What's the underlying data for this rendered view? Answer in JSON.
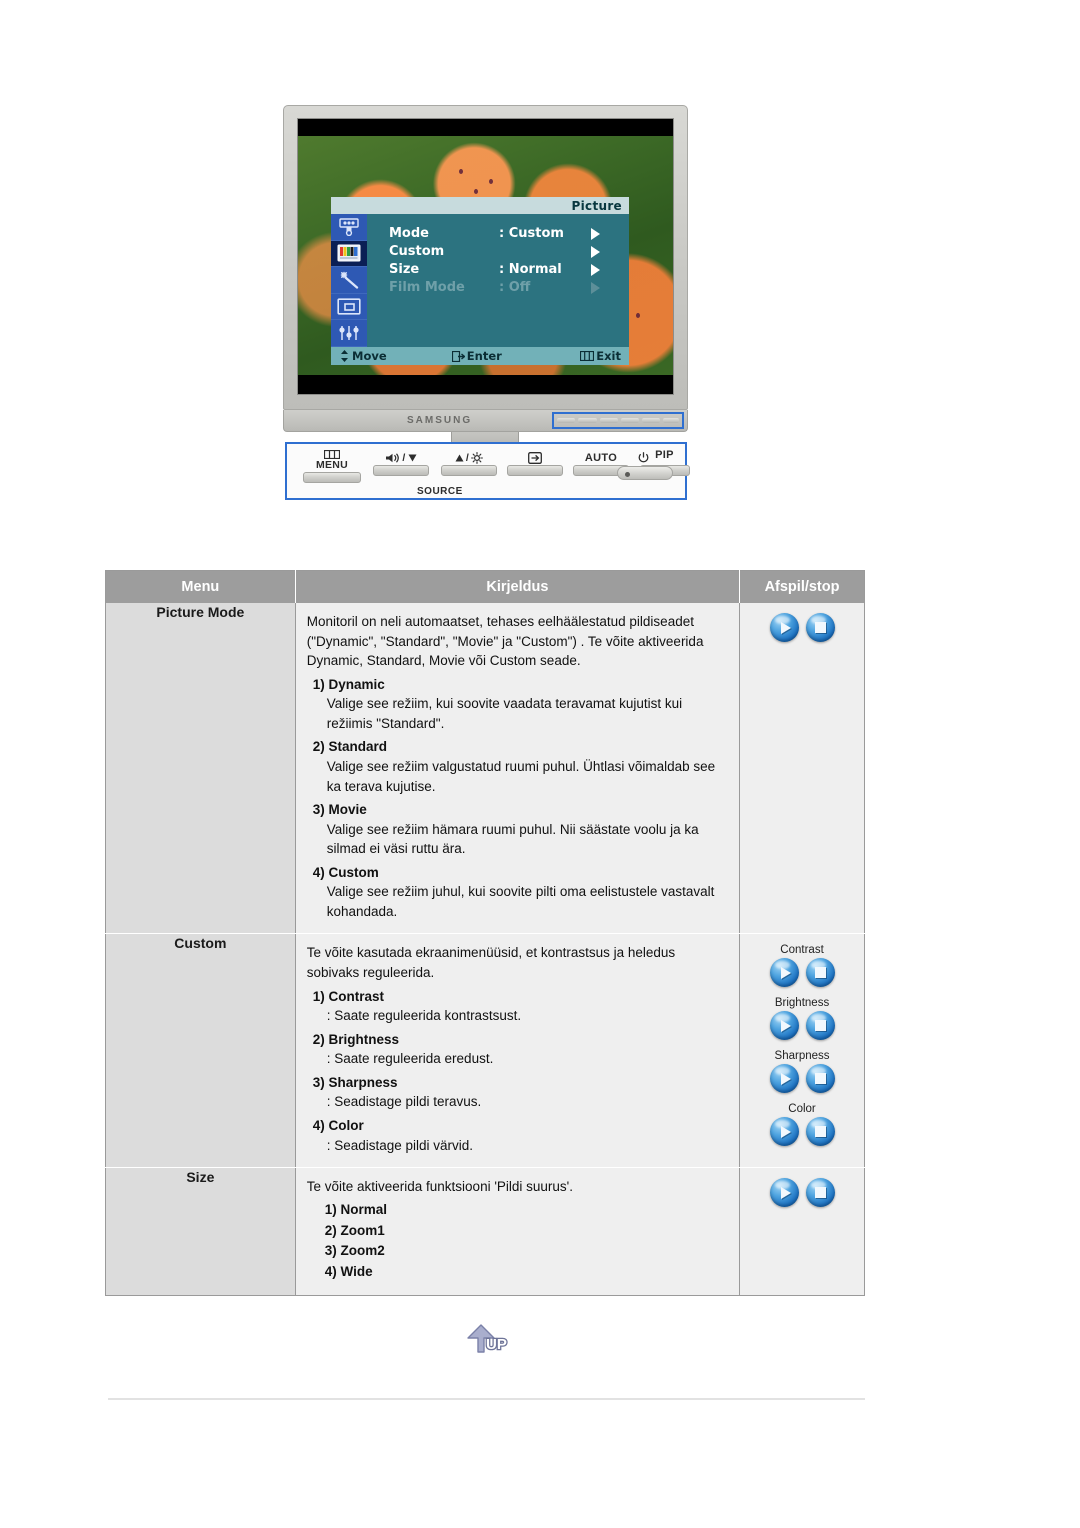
{
  "monitor": {
    "brand_logo": "SAMSUNG",
    "osd": {
      "title": "Picture",
      "rows": [
        {
          "label": "Mode",
          "value": ": Custom",
          "disabled": false
        },
        {
          "label": "Custom",
          "value": "",
          "disabled": false
        },
        {
          "label": "Size",
          "value": ": Normal",
          "disabled": false
        },
        {
          "label": "Film Mode",
          "value": ": Off",
          "disabled": true
        }
      ],
      "footer": {
        "move": "Move",
        "enter": "Enter",
        "exit": "Exit"
      },
      "sidebar_icons": [
        "display-settings-icon",
        "color-bars-icon",
        "magic-wand-icon",
        "pip-icon",
        "setup-sliders-icon"
      ]
    },
    "control_buttons": [
      {
        "caption": "MENU",
        "icon": "menu-icon"
      },
      {
        "caption": "/",
        "icon": "mute-down-icon"
      },
      {
        "caption": "/",
        "icon": "up-brightness-icon"
      },
      {
        "caption": "",
        "icon": "enter-source-icon"
      },
      {
        "caption": "AUTO",
        "icon": ""
      },
      {
        "caption": "PIP",
        "icon": ""
      },
      {
        "caption": "",
        "icon": "power-icon"
      }
    ],
    "source_caption": "SOURCE"
  },
  "table": {
    "headers": {
      "menu": "Menu",
      "description": "Kirjeldus",
      "playstop": "Afspil/stop"
    },
    "rows": [
      {
        "menu": "Picture Mode",
        "intro": "Monitoril on neli automaatset, tehases eelhäälestatud pildiseadet (\"Dynamic\", \"Standard\", \"Movie\" ja \"Custom\") . Te võite aktiveerida Dynamic, Standard, Movie või Custom seade.",
        "items": [
          {
            "head": "1) Dynamic",
            "body": "Valige see režiim, kui soovite vaadata teravamat kujutist kui režiimis \"Standard\"."
          },
          {
            "head": "2) Standard",
            "body": "Valige see režiim valgustatud ruumi puhul. Ühtlasi võimaldab see ka terava kujutise."
          },
          {
            "head": "3) Movie",
            "body": "Valige see režiim hämara ruumi puhul. Nii säästate voolu ja ka silmad ei väsi ruttu ära."
          },
          {
            "head": "4) Custom",
            "body": "Valige see režiim juhul, kui soovite pilti oma eelistustele vastavalt kohandada."
          }
        ],
        "plain_list": [],
        "play_groups": [
          {
            "label": "",
            "play": "play-icon",
            "stop": "stop-icon"
          }
        ]
      },
      {
        "menu": "Custom",
        "intro": "Te võite kasutada ekraanimenüüsid, et kontrastsus ja heledus sobivaks reguleerida.",
        "items": [
          {
            "head": "1) Contrast",
            "body": ": Saate reguleerida kontrastsust."
          },
          {
            "head": "2) Brightness",
            "body": ": Saate reguleerida eredust."
          },
          {
            "head": "3) Sharpness",
            "body": ": Seadistage pildi teravus."
          },
          {
            "head": "4) Color",
            "body": ": Seadistage pildi värvid."
          }
        ],
        "plain_list": [],
        "play_groups": [
          {
            "label": "Contrast",
            "play": "play-icon",
            "stop": "stop-icon"
          },
          {
            "label": "Brightness",
            "play": "play-icon",
            "stop": "stop-icon"
          },
          {
            "label": "Sharpness",
            "play": "play-icon",
            "stop": "stop-icon"
          },
          {
            "label": "Color",
            "play": "play-icon",
            "stop": "stop-icon"
          }
        ]
      },
      {
        "menu": "Size",
        "intro": "Te võite aktiveerida funktsiooni 'Pildi suurus'.",
        "items": [],
        "plain_list": [
          "1) Normal",
          "2) Zoom1",
          "3) Zoom2",
          "4) Wide"
        ],
        "play_groups": [
          {
            "label": "",
            "play": "play-icon",
            "stop": "stop-icon"
          }
        ]
      }
    ]
  },
  "footer": {
    "up_button_label": "UP"
  },
  "colors": {
    "osd_panel": "#2c7380",
    "osd_sidebar": "#2e59b4",
    "osd_titlebar": "#c7dbdd",
    "osd_footer": "#72b1b8",
    "table_header": "#9d9d9d",
    "menu_cell": "#dcdcdc",
    "desc_cell": "#efefef",
    "callout_border": "#2f6fd0",
    "sphere_blue": "#1a6fc0"
  }
}
